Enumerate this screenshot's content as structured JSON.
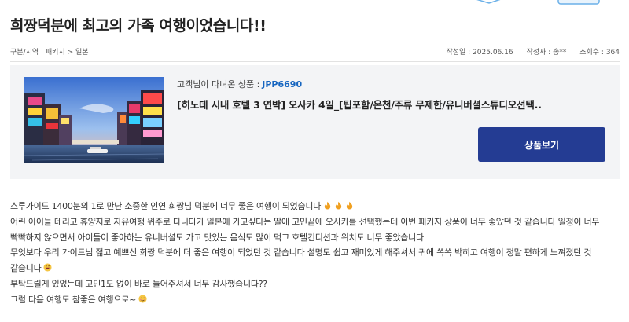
{
  "review": {
    "title": "희짱덕분에 최고의 가족 여행이었습니다!!",
    "category": "구분/지역 : 패키지 > 일본",
    "written_date": "작성일 : 2025.06.16",
    "author": "작성자 : 송**",
    "views": "조회수 : 364"
  },
  "product": {
    "visited_label": "고객님이 다녀온 상품 :",
    "code": "JPP6690",
    "name": "[히노데 시내 호텔 3 연박] 오사카 4일_[팁포함/온천/주류 무제한/유니버셜스튜디오선택..",
    "button_label": "상품보기",
    "thumbnail": "osaka-dotonbori-canal-photo"
  },
  "body": {
    "line1": "스루가이드 1400분의 1로 만난 소중한 인연 희짱님 덕분에 너무 좋은 여행이 되었습니다",
    "line1_emojis": [
      "fire",
      "fire",
      "fire"
    ],
    "line2": "어린 아이들 데리고 휴양지로 자유여행 위주로 다니다가 일본에 가고싶다는 딸에 고민끝에 오사카를 선택했는데 이번 패키지 상품이 너무 좋았던 것 같습니다 일정이 너무 빡빡하지 않으면서 아이들이 좋아하는 유니버셜도 가고 맛있는 음식도 많이 먹고 호텔컨디션과 위치도 너무 좋았습니다",
    "line3": "무엇보다 우리 가이드님 젊고 예쁘신 희짱 덕분에 더 좋은 여행이 되었던 것 같습니다 설명도 쉽고 재미있게 해주셔서 귀에 쏙쏙 박히고 여행이 정말 편하게 느껴졌던 것 같습니다",
    "line3_emoji": "grinning-face",
    "line4": "부탁드릴게 있었는데 고민1도 없이 바로 들어주셔서 너무 감사했습니다??",
    "line5": "그럼 다음 여행도 참좋은 여행으로~",
    "line5_emoji": "smiling-face"
  },
  "colors": {
    "accent_blue": "#243c93",
    "code_blue": "#1565c0",
    "card_bg": "#f3f4f6",
    "fire": "#f0a020"
  }
}
